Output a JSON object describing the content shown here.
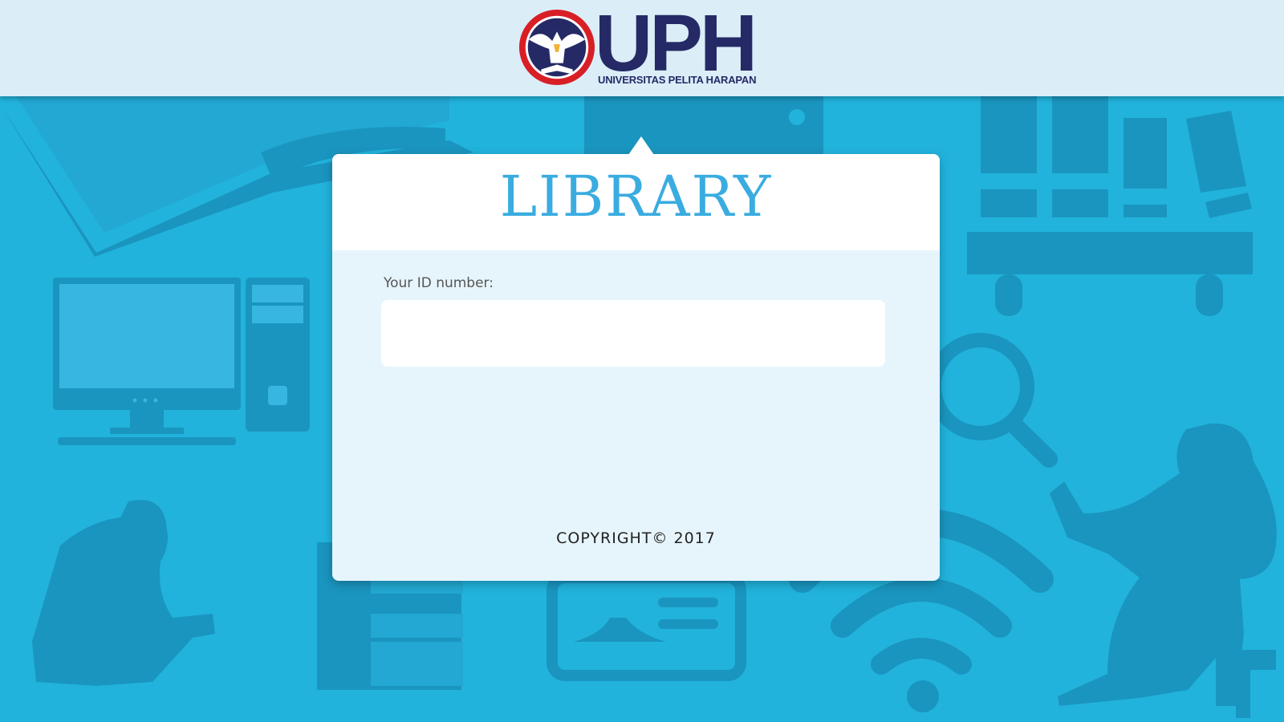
{
  "header": {
    "logo_text": "UPH",
    "logo_subtitle": "UNIVERSITAS PELITA HARAPAN",
    "seal_text": "UNIVERSITAS PELITA HARAPAN"
  },
  "login": {
    "title": "LIBRARY",
    "id_label": "Your ID number:",
    "id_value": "",
    "copyright": "COPYRIGHT© 2017"
  },
  "colors": {
    "background": "#21b3dc",
    "header_bg": "#dbeef8",
    "brand_navy": "#252a66",
    "title_blue": "#3aace0",
    "seal_red": "#d81f26"
  }
}
